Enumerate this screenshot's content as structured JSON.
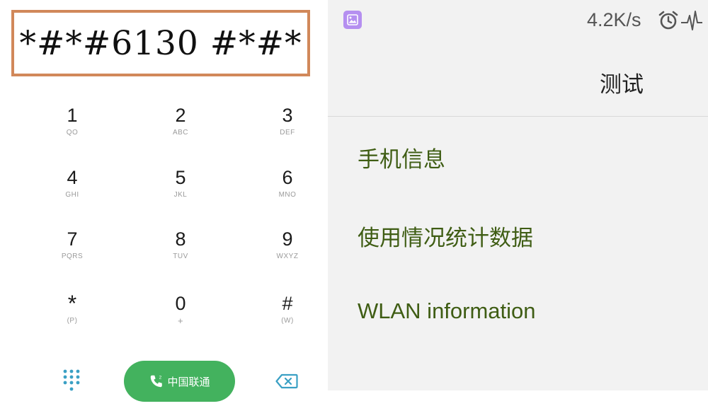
{
  "dialer": {
    "code": "*#*#6130 #*#*",
    "keys": [
      {
        "digit": "1",
        "letters": "QO"
      },
      {
        "digit": "2",
        "letters": "ABC"
      },
      {
        "digit": "3",
        "letters": "DEF"
      },
      {
        "digit": "4",
        "letters": "GHI"
      },
      {
        "digit": "5",
        "letters": "JKL"
      },
      {
        "digit": "6",
        "letters": "MNO"
      },
      {
        "digit": "7",
        "letters": "PQRS"
      },
      {
        "digit": "8",
        "letters": "TUV"
      },
      {
        "digit": "9",
        "letters": "WXYZ"
      },
      {
        "digit": "*",
        "letters": "(P)"
      },
      {
        "digit": "0",
        "letters": "+"
      },
      {
        "digit": "#",
        "letters": "(W)"
      }
    ],
    "call_label": "中国联通",
    "accent_color": "#43b25e",
    "icons": [
      "dialpad-grid-icon",
      "phone-sim-icon",
      "backspace-icon"
    ]
  },
  "test_screen": {
    "status": {
      "speed": "4.2K/s",
      "icons": [
        "gallery-app-icon",
        "alarm-clock-icon",
        "pulse-icon"
      ]
    },
    "title": "测试",
    "menu": [
      {
        "label": "手机信息"
      },
      {
        "label": "使用情况统计数据"
      },
      {
        "label": "WLAN information"
      }
    ],
    "menu_text_color": "#3f5d14"
  }
}
